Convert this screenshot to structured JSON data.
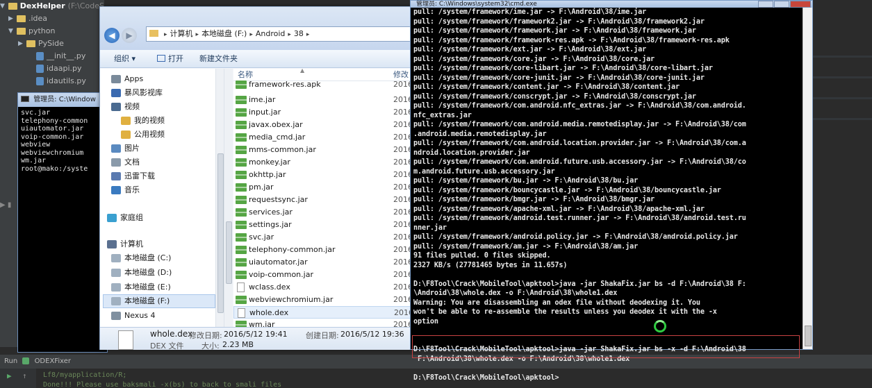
{
  "ide": {
    "project_name": "DexHelper",
    "project_path": "(F:\\CodeS",
    "tree": [
      {
        "label": ".idea",
        "indent": 1,
        "type": "folder"
      },
      {
        "label": "python",
        "indent": 1,
        "type": "folder"
      },
      {
        "label": "PySide",
        "indent": 2,
        "type": "folder"
      },
      {
        "label": "__init__.py",
        "indent": 3,
        "type": "py"
      },
      {
        "label": "idaapi.py",
        "indent": 3,
        "type": "py"
      },
      {
        "label": "idautils.py",
        "indent": 3,
        "type": "py"
      }
    ],
    "run_tab": "Run",
    "run_config": "ODEXFixer",
    "console_line1": "Lf8/myapplication/R;",
    "console_line2": "Done!!! Please use baksmali -x(bs) to back to smali files"
  },
  "cmd_small": {
    "title": "管理员: C:\\Window",
    "lines": [
      "svc.jar",
      "telephony-common",
      "uiautomator.jar",
      "voip-common.jar",
      "webview",
      "webviewchromium",
      "wm.jar",
      "root@mako:/syste"
    ]
  },
  "explorer": {
    "address": [
      "计算机",
      "本地磁盘 (F:)",
      "Android",
      "38"
    ],
    "toolbar": {
      "organize": "组织 ▾",
      "open": "打开",
      "new_folder": "新建文件夹"
    },
    "nav": [
      {
        "label": "Apps",
        "color": "#7a8a9a"
      },
      {
        "label": "暴风影视库",
        "color": "#3a6ab0"
      },
      {
        "label": "视频",
        "color": "#4a6a90"
      },
      {
        "label": "我的视频",
        "color": "#e0b040"
      },
      {
        "label": "公用视频",
        "color": "#e0b040"
      },
      {
        "label": "图片",
        "color": "#5a8ac0"
      },
      {
        "label": "文档",
        "color": "#8a9aaa"
      },
      {
        "label": "迅雷下载",
        "color": "#5a7ab0"
      },
      {
        "label": "音乐",
        "color": "#3a7ac0"
      },
      {
        "label": "家庭组",
        "color": "#3aa0d0"
      },
      {
        "label": "计算机",
        "color": "#5a7090"
      },
      {
        "label": "本地磁盘 (C:)",
        "color": "#a0b0c0"
      },
      {
        "label": "本地磁盘 (D:)",
        "color": "#a0b0c0"
      },
      {
        "label": "本地磁盘 (E:)",
        "color": "#a0b0c0"
      },
      {
        "label": "本地磁盘 (F:)",
        "color": "#a0b0c0"
      },
      {
        "label": "Nexus 4",
        "color": "#8090a0"
      }
    ],
    "header_name": "名称",
    "header_date": "修改",
    "files": [
      {
        "name": "framework-res.apk",
        "date": "2016"
      },
      {
        "name": "ime.jar",
        "date": "2016"
      },
      {
        "name": "input.jar",
        "date": "2016"
      },
      {
        "name": "javax.obex.jar",
        "date": "2016"
      },
      {
        "name": "media_cmd.jar",
        "date": "2016"
      },
      {
        "name": "mms-common.jar",
        "date": "2016"
      },
      {
        "name": "monkey.jar",
        "date": "2016"
      },
      {
        "name": "okhttp.jar",
        "date": "2016"
      },
      {
        "name": "pm.jar",
        "date": "2016"
      },
      {
        "name": "requestsync.jar",
        "date": "2016"
      },
      {
        "name": "services.jar",
        "date": "2016"
      },
      {
        "name": "settings.jar",
        "date": "2016"
      },
      {
        "name": "svc.jar",
        "date": "2016"
      },
      {
        "name": "telephony-common.jar",
        "date": "2016"
      },
      {
        "name": "uiautomator.jar",
        "date": "2016"
      },
      {
        "name": "voip-common.jar",
        "date": "2016"
      },
      {
        "name": "wclass.dex",
        "date": "2016"
      },
      {
        "name": "webviewchromium.jar",
        "date": "2016"
      },
      {
        "name": "whole.dex",
        "date": "2016"
      },
      {
        "name": "wm.jar",
        "date": "2016"
      }
    ],
    "details": {
      "name": "whole.dex",
      "modified_label": "修改日期:",
      "modified": "2016/5/12 19:41",
      "created_label": "创建日期:",
      "created": "2016/5/12 19:36",
      "type": "DEX 文件",
      "size_label": "大小:",
      "size": "2.23 MB"
    }
  },
  "cmd": {
    "title": "管理员: C:\\Windows\\system32\\cmd.exe",
    "lines": [
      "pull: /system/framework/ime.jar -> F:\\Android\\38/ime.jar",
      "pull: /system/framework/framework2.jar -> F:\\Android\\38/framework2.jar",
      "pull: /system/framework/framework.jar -> F:\\Android\\38/framework.jar",
      "pull: /system/framework/framework-res.apk -> F:\\Android\\38/framework-res.apk",
      "pull: /system/framework/ext.jar -> F:\\Android\\38/ext.jar",
      "pull: /system/framework/core.jar -> F:\\Android\\38/core.jar",
      "pull: /system/framework/core-libart.jar -> F:\\Android\\38/core-libart.jar",
      "pull: /system/framework/core-junit.jar -> F:\\Android\\38/core-junit.jar",
      "pull: /system/framework/content.jar -> F:\\Android\\38/content.jar",
      "pull: /system/framework/conscrypt.jar -> F:\\Android\\38/conscrypt.jar",
      "pull: /system/framework/com.android.nfc_extras.jar -> F:\\Android\\38/com.android.",
      "nfc_extras.jar",
      "pull: /system/framework/com.android.media.remotedisplay.jar -> F:\\Android\\38/com",
      ".android.media.remotedisplay.jar",
      "pull: /system/framework/com.android.location.provider.jar -> F:\\Android\\38/com.a",
      "ndroid.location.provider.jar",
      "pull: /system/framework/com.android.future.usb.accessory.jar -> F:\\Android\\38/co",
      "m.android.future.usb.accessory.jar",
      "pull: /system/framework/bu.jar -> F:\\Android\\38/bu.jar",
      "pull: /system/framework/bouncycastle.jar -> F:\\Android\\38/bouncycastle.jar",
      "pull: /system/framework/bmgr.jar -> F:\\Android\\38/bmgr.jar",
      "pull: /system/framework/apache-xml.jar -> F:\\Android\\38/apache-xml.jar",
      "pull: /system/framework/android.test.runner.jar -> F:\\Android\\38/android.test.ru",
      "nner.jar",
      "pull: /system/framework/android.policy.jar -> F:\\Android\\38/android.policy.jar",
      "pull: /system/framework/am.jar -> F:\\Android\\38/am.jar",
      "91 files pulled. 0 files skipped.",
      "2327 KB/s (27781465 bytes in 11.657s)",
      "",
      "D:\\F8Tool\\Crack\\MobileTool\\apktool>java -jar ShakaFix.jar bs -d F:\\Android\\38 F:",
      "\\Android\\38\\whole.dex -o F:\\Android\\38\\whole1.dex",
      "Warning: You are disassembling an odex file without deodexing it. You",
      "won't be able to re-assemble the results unless you deodex it with the -x",
      "option",
      "",
      "",
      "D:\\F8Tool\\Crack\\MobileTool\\apktool>java -jar ShakaFix.jar bs -x -d F:\\Android\\38",
      " F:\\Android\\38\\whole.dex -o F:\\Android\\38\\whole1.dex",
      "",
      "D:\\F8Tool\\Crack\\MobileTool\\apktool>"
    ]
  }
}
